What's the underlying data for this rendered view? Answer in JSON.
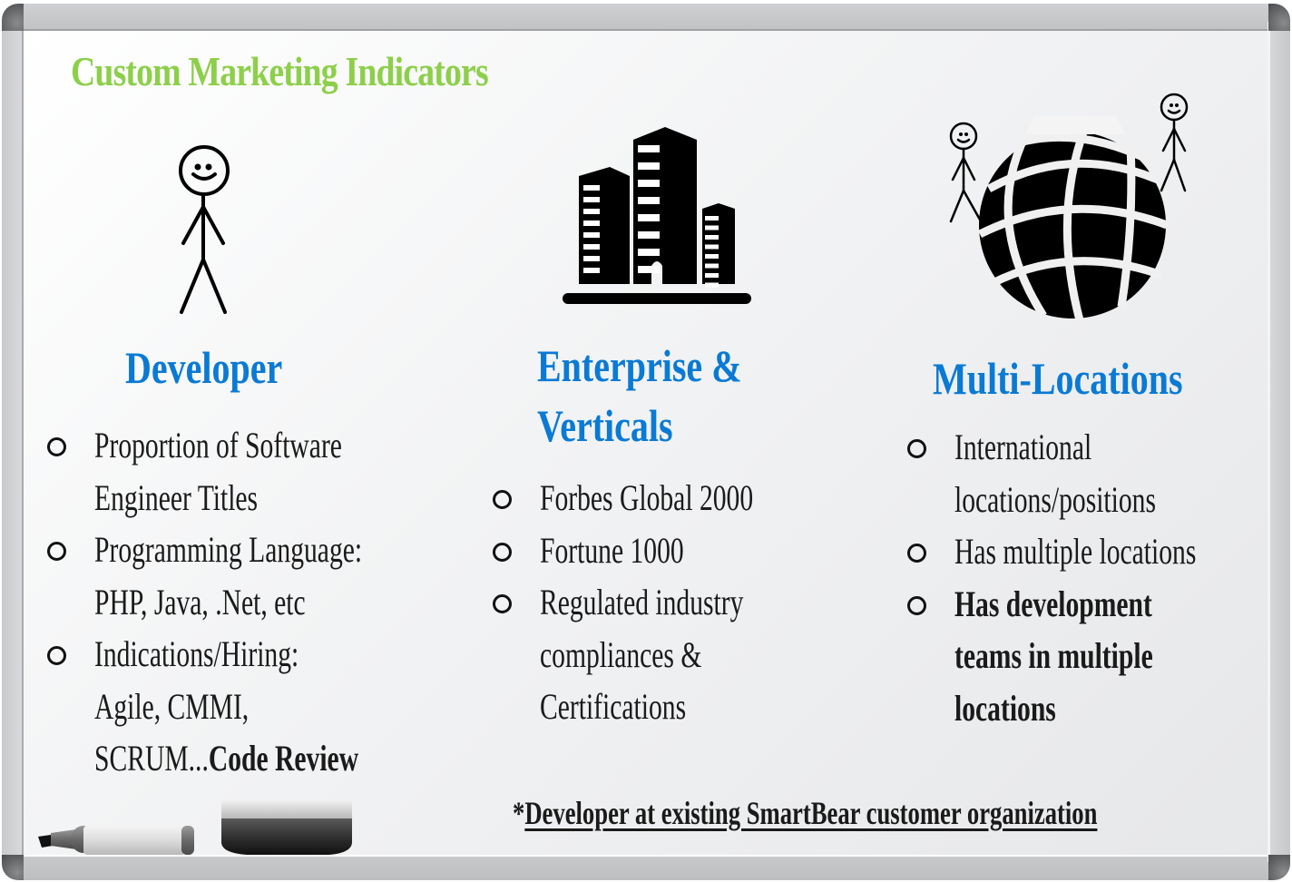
{
  "title": "Custom Marketing Indicators",
  "colors": {
    "title": "#8dcf4a",
    "heading": "#0a7ad4",
    "text": "#1a1a1a"
  },
  "columns": [
    {
      "icon": "stick-figure-icon",
      "heading_lines": [
        "Developer"
      ],
      "items": [
        {
          "lines": [
            "Proportion of Software",
            "Engineer Titles"
          ]
        },
        {
          "lines": [
            "Programming Language:",
            "PHP, Java, .Net, etc"
          ]
        },
        {
          "lines": [
            "Indications/Hiring:",
            "Agile, CMMI,"
          ],
          "last_line_plain": "SCRUM...",
          "last_line_bold": "Code Review"
        }
      ]
    },
    {
      "icon": "office-buildings-icon",
      "heading_lines": [
        "Enterprise &",
        "Verticals"
      ],
      "items": [
        {
          "lines": [
            "Forbes Global 2000"
          ]
        },
        {
          "lines": [
            "Fortune 1000"
          ]
        },
        {
          "lines": [
            "Regulated industry",
            "compliances &",
            "Certifications"
          ]
        }
      ]
    },
    {
      "icon": "globe-with-people-icon",
      "heading_lines": [
        "Multi-Locations"
      ],
      "items": [
        {
          "lines": [
            "International",
            "locations/positions"
          ]
        },
        {
          "lines": [
            "Has multiple locations"
          ]
        },
        {
          "lines": [
            "Has development",
            "teams in multiple",
            "locations"
          ],
          "bold": true
        }
      ]
    }
  ],
  "footnote": {
    "prefix": "*",
    "text": "Developer at existing SmartBear customer organization"
  },
  "tray": {
    "marker": "marker-icon",
    "eraser": "eraser-icon"
  }
}
